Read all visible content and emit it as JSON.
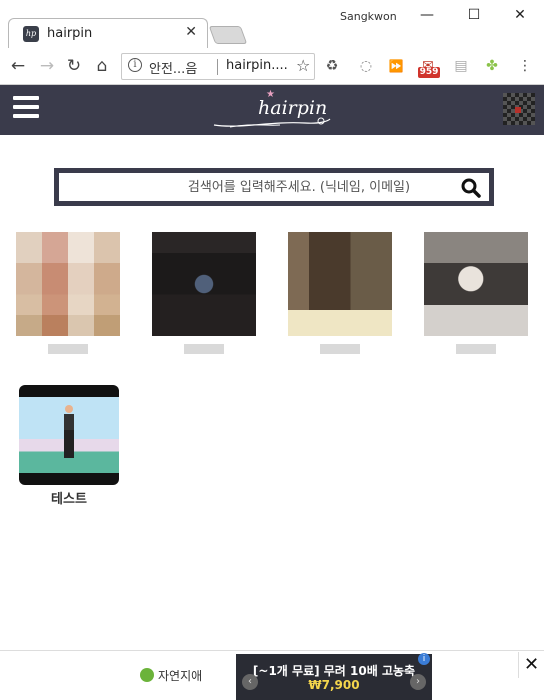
{
  "browser": {
    "tab_title": "hairpin",
    "tab_favicon": "hp",
    "user": "Sangkwon",
    "omnibox_secure": "안전...음",
    "omnibox_url": "hairpin....",
    "mail_badge": "959"
  },
  "site": {
    "logo_text": "hairpin",
    "search_placeholder": "검색어를 입력해주세요. (닉네임, 이메일)"
  },
  "videos": [
    {
      "title": "테스트"
    }
  ],
  "ad": {
    "brand": "자연지애",
    "line1": "[~1개 무료] 무려 10배 고농축",
    "price": "₩7,900",
    "info": "i"
  }
}
